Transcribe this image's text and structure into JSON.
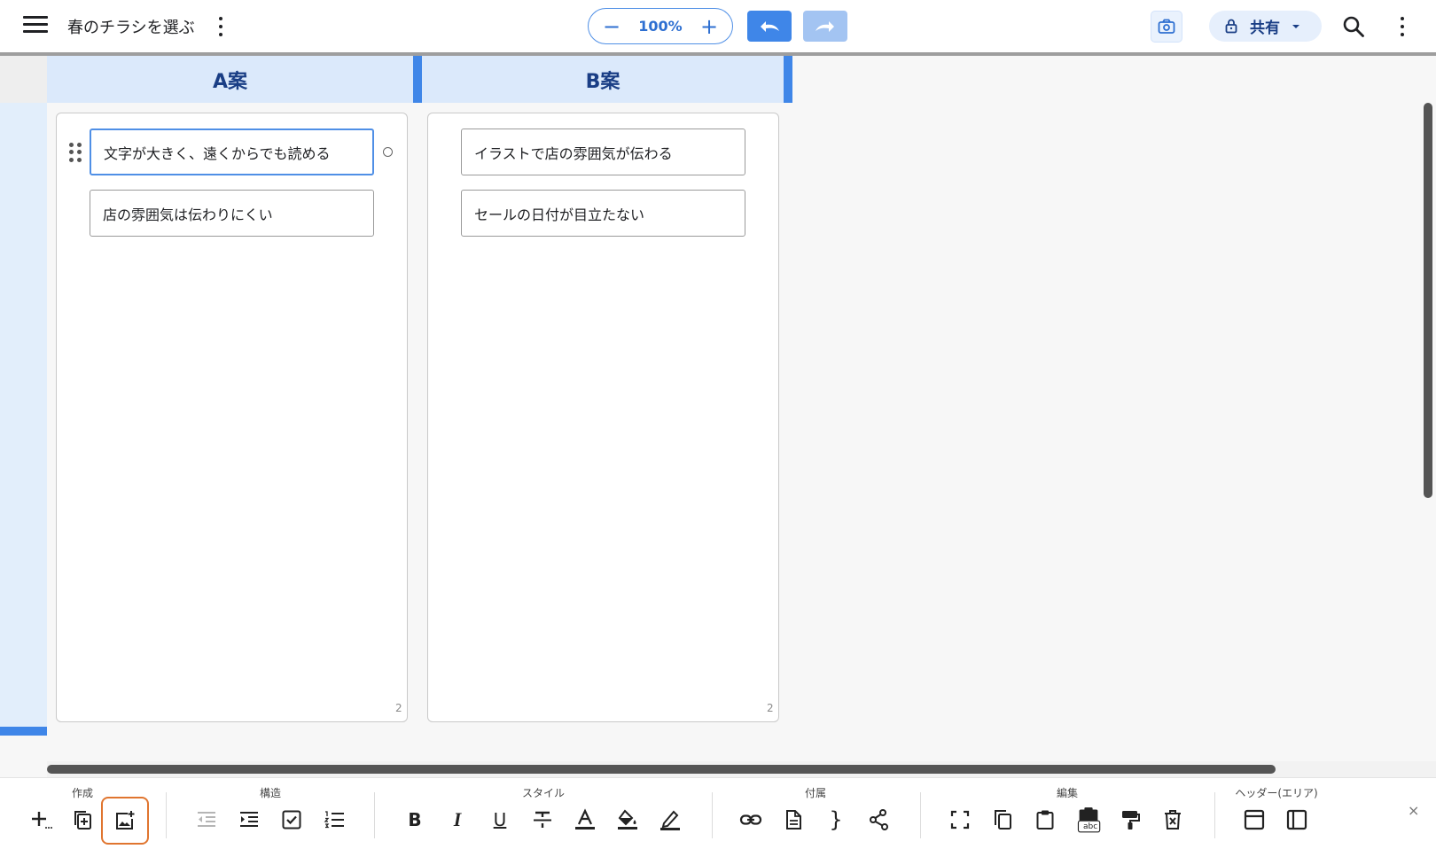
{
  "header": {
    "title": "春のチラシを選ぶ",
    "zoom": {
      "minus": "−",
      "value": "100%",
      "plus": "+"
    },
    "share_label": "共有"
  },
  "columns": [
    {
      "title": "A案",
      "count": "2",
      "cards": [
        "文字が大きく、遠くからでも読める",
        "店の雰囲気は伝わりにくい"
      ]
    },
    {
      "title": "B案",
      "count": "2",
      "cards": [
        "イラストで店の雰囲気が伝わる",
        "セールの日付が目立たない"
      ]
    }
  ],
  "toolbar": {
    "groups": [
      "作成",
      "構造",
      "スタイル",
      "付属",
      "編集",
      "ヘッダー(エリア)"
    ],
    "bold": "B",
    "italic": "I",
    "underline": "U",
    "braces": "}",
    "paste_label": "abc",
    "close": "×"
  },
  "colors": {
    "accent": "#3f86e8",
    "accent_light": "#dbe9fb",
    "highlight": "#e0752f",
    "header_text": "#1a3e85"
  }
}
